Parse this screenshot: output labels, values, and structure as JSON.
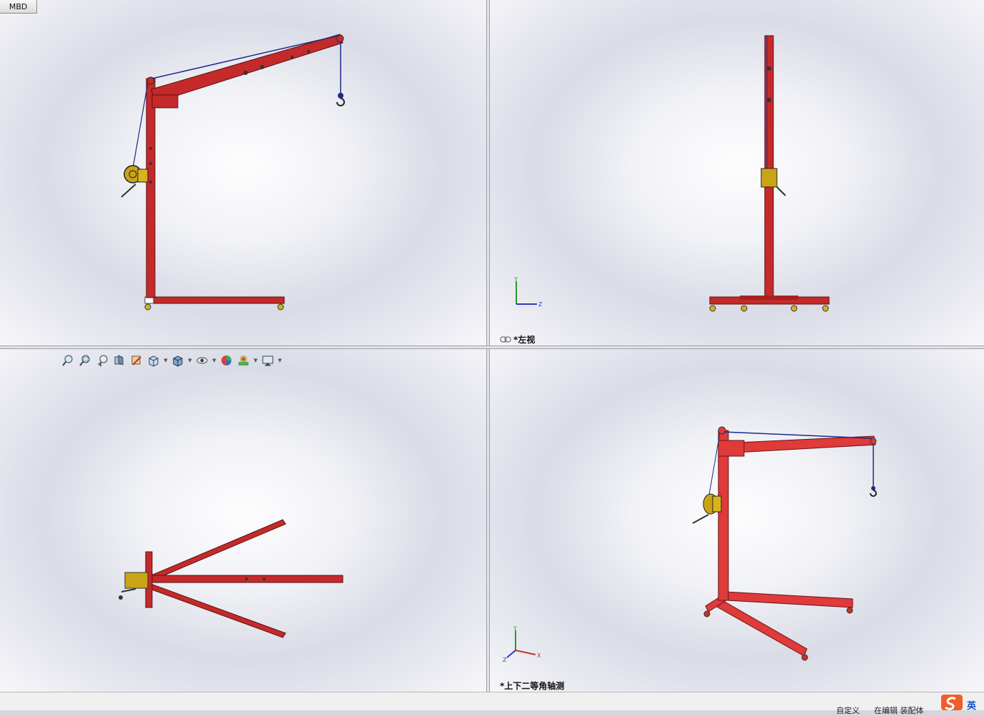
{
  "top_tab": {
    "label": "MBD"
  },
  "viewports": {
    "top_left": {
      "name": "front view",
      "label": ""
    },
    "top_right": {
      "name": "left view",
      "label": "*左视"
    },
    "bottom_left": {
      "name": "top view",
      "label": ""
    },
    "bottom_right": {
      "name": "dimetric view",
      "label": "*上下二等角轴测"
    }
  },
  "triad": {
    "x": "X",
    "y": "Y",
    "z": "Z"
  },
  "heads_up_toolbar": [
    {
      "icon": "zoom-to-fit-icon"
    },
    {
      "icon": "zoom-to-area-icon"
    },
    {
      "icon": "previous-view-icon"
    },
    {
      "icon": "section-view-icon"
    },
    {
      "icon": "dynamic-annotation-icon"
    },
    {
      "icon": "view-orientation-icon",
      "dropdown": true
    },
    {
      "icon": "display-style-icon",
      "dropdown": true
    },
    {
      "icon": "hide-show-items-icon",
      "dropdown": true
    },
    {
      "icon": "edit-appearance-icon"
    },
    {
      "icon": "apply-scene-icon",
      "dropdown": true
    },
    {
      "icon": "view-settings-icon",
      "dropdown": true
    }
  ],
  "status_bar": {
    "custom": "自定义",
    "editing": "在编辑 装配体"
  },
  "ime": {
    "label": "英"
  },
  "colors": {
    "frame": "#c42a2a",
    "cable": "#1c2a8a",
    "winch": "#c9a516"
  }
}
